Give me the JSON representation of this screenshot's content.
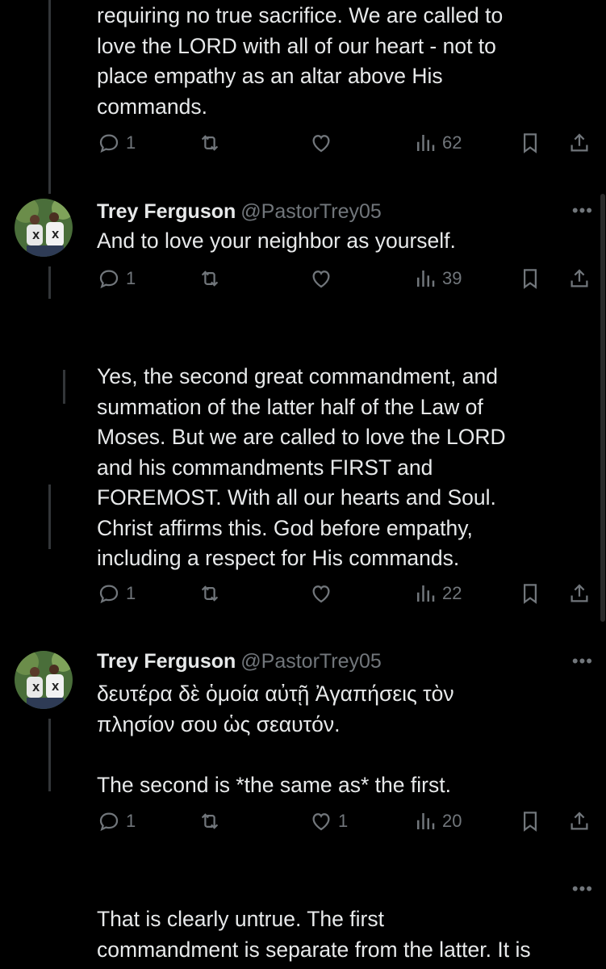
{
  "posts": [
    {
      "body": "requiring no true sacrifice.  We are called to\nlove the LORD with all of our heart - not to\nplace empathy as an altar above His\ncommands.",
      "replies": "1",
      "reposts": "",
      "likes": "",
      "views": "62"
    },
    {
      "name": "Trey Ferguson",
      "handle": "@PastorTrey05",
      "body": "And to love your neighbor as yourself.",
      "replies": "1",
      "reposts": "",
      "likes": "",
      "views": "39"
    },
    {
      "body": "Yes, the second great commandment, and\nsummation of the latter half of the Law of\nMoses.  But we are called to love the LORD\nand his commandments FIRST and\nFOREMOST. With all our hearts and Soul.\nChrist affirms this. God before empathy,\nincluding a respect for His commands.",
      "replies": "1",
      "reposts": "",
      "likes": "",
      "views": "22"
    },
    {
      "name": "Trey Ferguson",
      "handle": "@PastorTrey05",
      "body": "δευτέρα δὲ ὁμοία αὐτῇ Ἀγαπήσεις τὸν\nπλησίον σου ὡς σεαυτόν.\n\nThe second is *the same as* the first.",
      "replies": "1",
      "reposts": "",
      "likes": "1",
      "views": "20"
    },
    {
      "body": "That is clearly untrue.  The first\ncommandment is separate from the latter. It is"
    }
  ],
  "more_label": "•••",
  "icons": [
    "reply-icon",
    "repost-icon",
    "like-icon",
    "views-icon",
    "bookmark-icon",
    "share-icon",
    "more-icon"
  ],
  "colors": {
    "background": "#000000",
    "text": "#e7e9ea",
    "muted": "#71767b"
  }
}
